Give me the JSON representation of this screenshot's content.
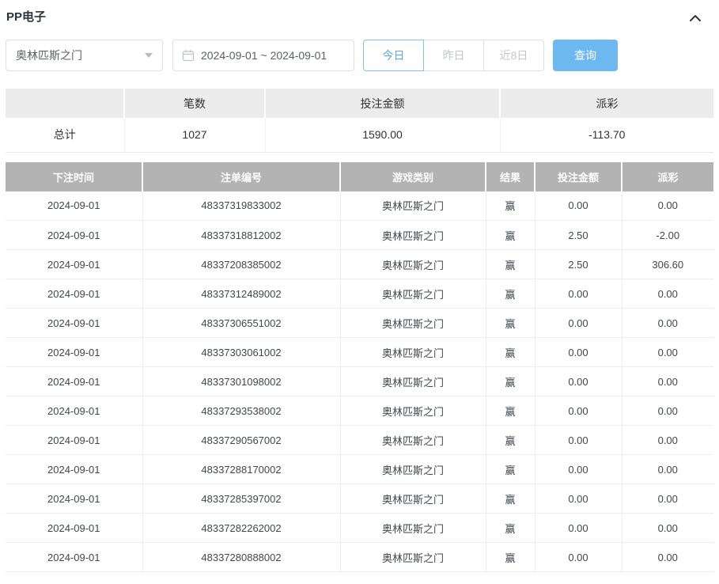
{
  "panel": {
    "title": "PP电子",
    "collapse_icon": "chevron-up"
  },
  "filters": {
    "game_select": {
      "value": "奥林匹斯之门",
      "icon": "caret-down-icon"
    },
    "date_range": {
      "value": "2024-09-01 ~ 2024-09-01",
      "icon": "calendar-icon"
    },
    "quick_buttons": [
      {
        "label": "今日",
        "active": true
      },
      {
        "label": "昨日",
        "active": false
      },
      {
        "label": "近8日",
        "active": false
      }
    ],
    "query_label": "查询"
  },
  "summary": {
    "columns": [
      "",
      "笔数",
      "投注金额",
      "派彩"
    ],
    "row_label": "总计",
    "count": "1027",
    "bet_amount": "1590.00",
    "payout": "-113.70"
  },
  "table": {
    "columns": [
      "下注时间",
      "注单编号",
      "游戏类别",
      "结果",
      "投注金额",
      "派彩"
    ],
    "rows": [
      [
        "2024-09-01",
        "48337319833002",
        "奥林匹斯之门",
        "赢",
        "0.00",
        "0.00"
      ],
      [
        "2024-09-01",
        "48337318812002",
        "奥林匹斯之门",
        "赢",
        "2.50",
        "-2.00"
      ],
      [
        "2024-09-01",
        "48337208385002",
        "奥林匹斯之门",
        "赢",
        "2.50",
        "306.60"
      ],
      [
        "2024-09-01",
        "48337312489002",
        "奥林匹斯之门",
        "赢",
        "0.00",
        "0.00"
      ],
      [
        "2024-09-01",
        "48337306551002",
        "奥林匹斯之门",
        "赢",
        "0.00",
        "0.00"
      ],
      [
        "2024-09-01",
        "48337303061002",
        "奥林匹斯之门",
        "赢",
        "0.00",
        "0.00"
      ],
      [
        "2024-09-01",
        "48337301098002",
        "奥林匹斯之门",
        "赢",
        "0.00",
        "0.00"
      ],
      [
        "2024-09-01",
        "48337293538002",
        "奥林匹斯之门",
        "赢",
        "0.00",
        "0.00"
      ],
      [
        "2024-09-01",
        "48337290567002",
        "奥林匹斯之门",
        "赢",
        "0.00",
        "0.00"
      ],
      [
        "2024-09-01",
        "48337288170002",
        "奥林匹斯之门",
        "赢",
        "0.00",
        "0.00"
      ],
      [
        "2024-09-01",
        "48337285397002",
        "奥林匹斯之门",
        "赢",
        "0.00",
        "0.00"
      ],
      [
        "2024-09-01",
        "48337282262002",
        "奥林匹斯之门",
        "赢",
        "0.00",
        "0.00"
      ],
      [
        "2024-09-01",
        "48337280888002",
        "奥林匹斯之门",
        "赢",
        "0.00",
        "0.00"
      ]
    ]
  },
  "colors": {
    "accent_blue": "#6db8f0",
    "active_tab_blue": "#55aaea",
    "negative_red": "#f25050",
    "table_header_gray": "#b3b3b3",
    "summary_header_gray": "#ececec"
  }
}
